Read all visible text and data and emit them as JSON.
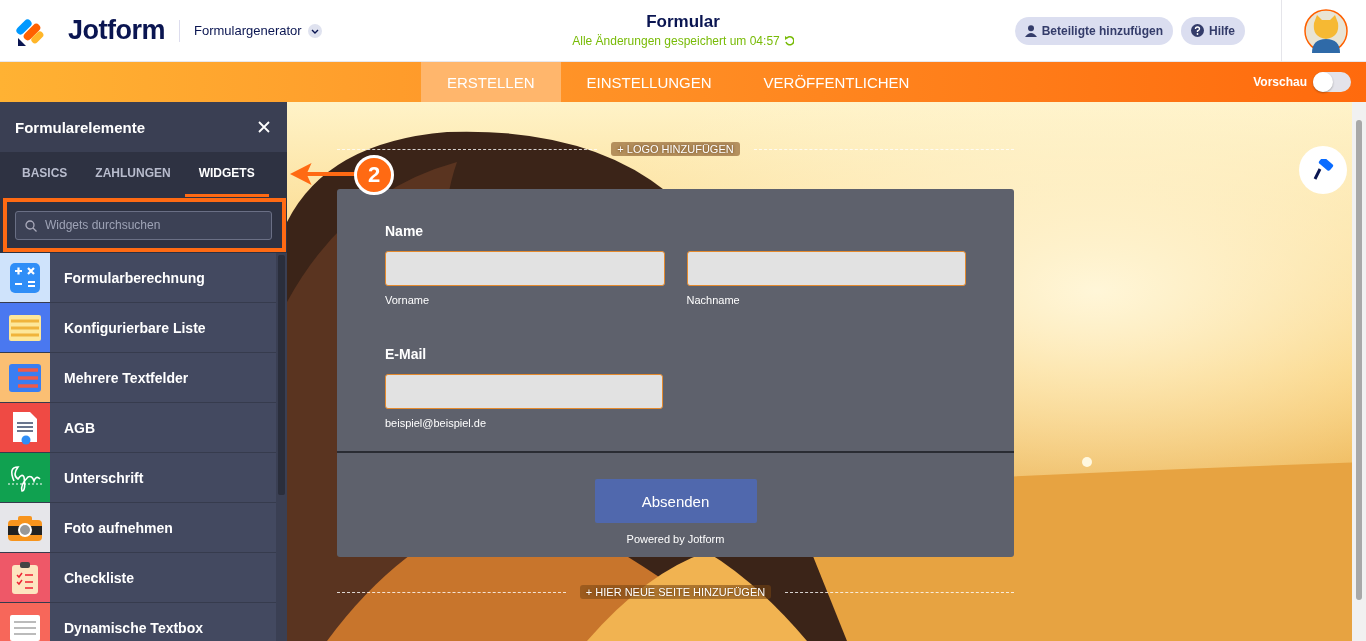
{
  "header": {
    "logo": "Jotform",
    "app_menu": "Formulargenerator",
    "title": "Formular",
    "status": "Alle Änderungen gespeichert um 04:57",
    "buttons": [
      {
        "kind": "person",
        "label": "Beteiligte hinzufügen"
      },
      {
        "kind": "help",
        "label": "Hilfe"
      }
    ]
  },
  "nav": {
    "tabs": [
      {
        "label": "ERSTELLEN",
        "selected": true
      },
      {
        "label": "EINSTELLUNGEN",
        "selected": false
      },
      {
        "label": "VERÖFFENTLICHEN",
        "selected": false
      }
    ],
    "preview": {
      "label": "Vorschau",
      "on": false
    }
  },
  "sidebar": {
    "title": "Formularelemente",
    "tabs": [
      {
        "label": "BASICS",
        "selected": false
      },
      {
        "label": "ZAHLUNGEN",
        "selected": false
      },
      {
        "label": "WIDGETS",
        "selected": true
      }
    ],
    "search": {
      "placeholder": "Widgets durchsuchen"
    },
    "items": [
      {
        "label": "Formularberechnung",
        "color": "#cfe3fb"
      },
      {
        "label": "Konfigurierbare Liste",
        "color": "#4a78f0"
      },
      {
        "label": "Mehrere Textfelder",
        "color": "#fbbf73"
      },
      {
        "label": "AGB",
        "color": "#ef4a44"
      },
      {
        "label": "Unterschrift",
        "color": "#10a150"
      },
      {
        "label": "Foto aufnehmen",
        "color": "#e6e6ea"
      },
      {
        "label": "Checkliste",
        "color": "#ee5868"
      },
      {
        "label": "Dynamische Textbox",
        "color": "#f7675a"
      }
    ]
  },
  "annotation": {
    "step": "2"
  },
  "canvas": {
    "add_logo": "+ LOGO HINZUFÜGEN",
    "add_page": "+ HIER NEUE SEITE HINZUFÜGEN",
    "form": {
      "name_label": "Name",
      "name_fields": [
        {
          "sublabel": "Vorname"
        },
        {
          "sublabel": "Nachname"
        }
      ],
      "email_label": "E-Mail",
      "email_sublabel": "beispiel@beispiel.de",
      "submit": "Absenden",
      "powered": "Powered by Jotform"
    }
  }
}
